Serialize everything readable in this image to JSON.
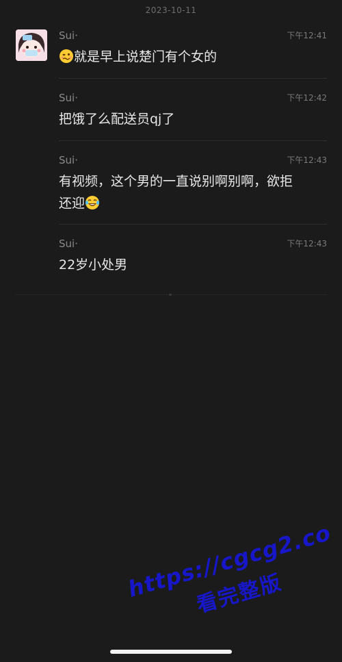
{
  "chat": {
    "date": "2023-10-11",
    "messages": [
      {
        "sender": "Sui·",
        "time": "下午12:41",
        "text": "就是早上说楚门有个女的"
      },
      {
        "sender": "Sui·",
        "time": "下午12:42",
        "text": "把饿了么配送员qj了"
      },
      {
        "sender": "Sui·",
        "time": "下午12:43",
        "text_line1": "有视频，这个男的一直说别啊别啊，欲拒",
        "text_line2": "还迎"
      },
      {
        "sender": "Sui·",
        "time": "下午12:43",
        "text": "22岁小处男"
      }
    ]
  },
  "watermark": {
    "url": "https://cgcg2.co",
    "caption": "看完整版"
  },
  "icons": {
    "avatar": "cartoon-girl-avatar",
    "emoji_1": "woozy-face-emoji",
    "emoji_2": "laughing-tears-emoji"
  },
  "colors": {
    "background": "#1b1b1b",
    "watermark": "#1717c9"
  }
}
